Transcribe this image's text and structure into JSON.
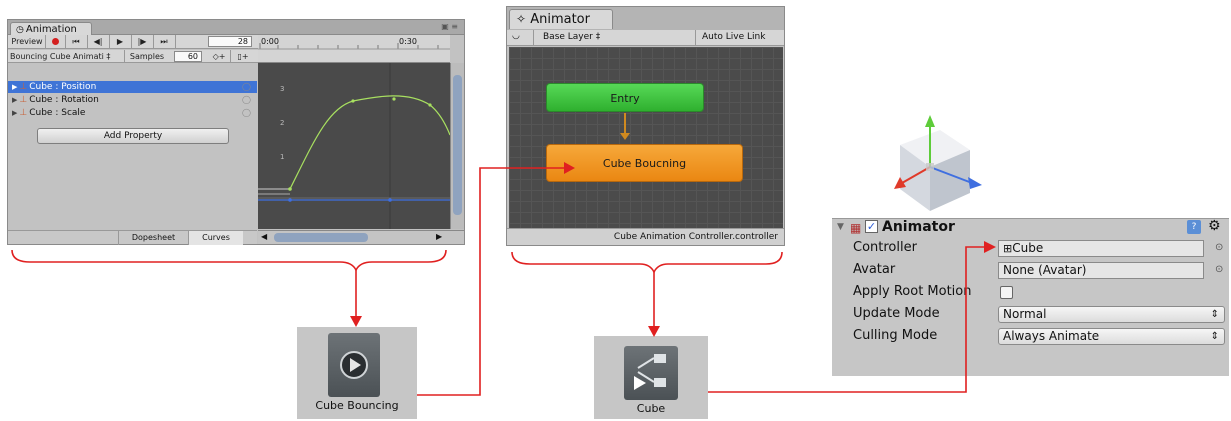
{
  "animation_window": {
    "tab_title": "Animation",
    "preview_label": "Preview",
    "frame_value": "28",
    "clip_dropdown": "Bouncing Cube Animati ‡",
    "samples_label": "Samples",
    "samples_value": "60",
    "timeline_ticks": [
      "0:00",
      "0:30"
    ],
    "properties": [
      {
        "label": "Cube : Position",
        "selected": true
      },
      {
        "label": "Cube : Rotation",
        "selected": false
      },
      {
        "label": "Cube : Scale",
        "selected": false
      }
    ],
    "add_property_label": "Add Property",
    "bottom_tabs": [
      "Dopesheet",
      "Curves"
    ],
    "curve_axis_ticks": [
      "3",
      "2",
      "1"
    ]
  },
  "animator_window": {
    "tab_title": "Animator",
    "layer_dropdown": "Base Layer ‡",
    "auto_live_link": "Auto Live Link",
    "entry_node": "Entry",
    "state_node": "Cube Boucning",
    "controller_file": "Cube Animation Controller.controller"
  },
  "assets": {
    "clip_label": "Cube Bouncing",
    "controller_label": "Cube"
  },
  "inspector": {
    "component_title": "Animator",
    "fields": {
      "controller_label": "Controller",
      "controller_value": "Cube",
      "avatar_label": "Avatar",
      "avatar_value": "None (Avatar)",
      "apply_root_motion_label": "Apply Root Motion",
      "update_mode_label": "Update Mode",
      "update_mode_value": "Normal",
      "culling_mode_label": "Culling Mode",
      "culling_mode_value": "Always Animate"
    }
  },
  "colors": {
    "arrow": "#e02020",
    "entry_node": "#3fc43f",
    "state_node": "#f0921a",
    "selection": "#3f74d6",
    "curve": "#a8e060",
    "flat_curve": "#3f6fe0"
  }
}
